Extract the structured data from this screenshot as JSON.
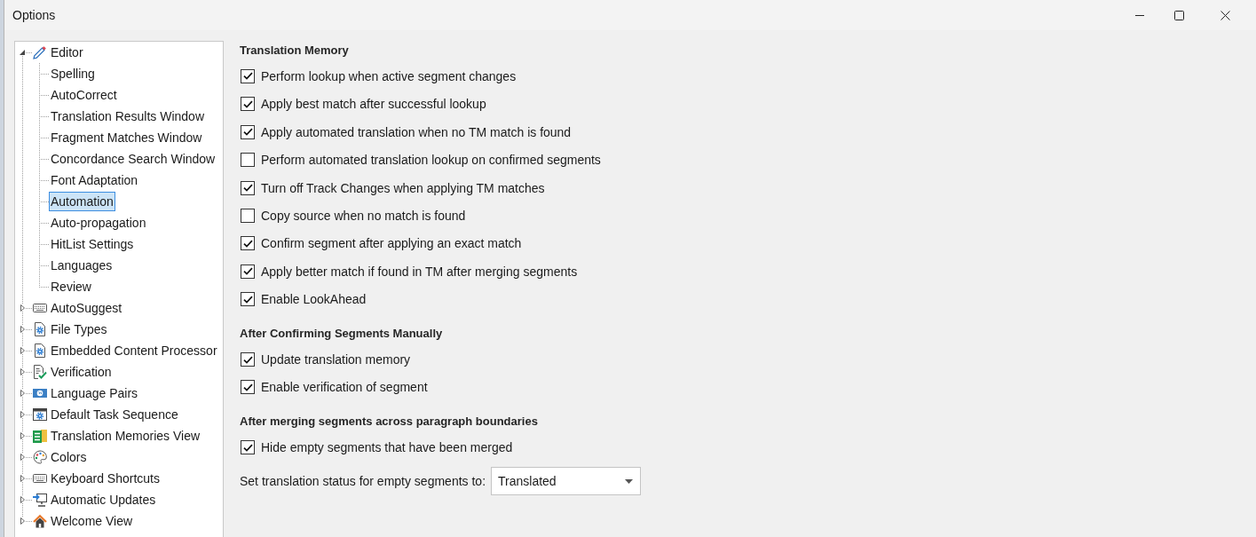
{
  "window": {
    "title": "Options"
  },
  "tree": [
    {
      "label": "Editor",
      "expanded": true,
      "selected": false,
      "children": [
        {
          "label": "Spelling",
          "selected": false
        },
        {
          "label": "AutoCorrect",
          "selected": false
        },
        {
          "label": "Translation Results Window",
          "selected": false
        },
        {
          "label": "Fragment Matches Window",
          "selected": false
        },
        {
          "label": "Concordance Search Window",
          "selected": false
        },
        {
          "label": "Font Adaptation",
          "selected": false
        },
        {
          "label": "Automation",
          "selected": true
        },
        {
          "label": "Auto-propagation",
          "selected": false
        },
        {
          "label": "HitList Settings",
          "selected": false
        },
        {
          "label": "Languages",
          "selected": false
        },
        {
          "label": "Review",
          "selected": false
        }
      ]
    },
    {
      "label": "AutoSuggest",
      "expanded": false,
      "selected": false
    },
    {
      "label": "File Types",
      "expanded": false,
      "selected": false
    },
    {
      "label": "Embedded Content Processor",
      "expanded": false,
      "selected": false
    },
    {
      "label": "Verification",
      "expanded": false,
      "selected": false
    },
    {
      "label": "Language Pairs",
      "expanded": false,
      "selected": false
    },
    {
      "label": "Default Task Sequence",
      "expanded": false,
      "selected": false
    },
    {
      "label": "Translation Memories View",
      "expanded": false,
      "selected": false
    },
    {
      "label": "Colors",
      "expanded": false,
      "selected": false
    },
    {
      "label": "Keyboard Shortcuts",
      "expanded": false,
      "selected": false
    },
    {
      "label": "Automatic Updates",
      "expanded": false,
      "selected": false
    },
    {
      "label": "Welcome View",
      "expanded": false,
      "selected": false
    }
  ],
  "sections": [
    {
      "heading": "Translation Memory",
      "items": [
        {
          "kind": "checkbox",
          "label": "Perform lookup when active segment changes",
          "checked": true
        },
        {
          "kind": "checkbox",
          "label": "Apply best match after successful lookup",
          "checked": true
        },
        {
          "kind": "checkbox",
          "label": "Apply automated translation when no TM match is found",
          "checked": true
        },
        {
          "kind": "checkbox",
          "label": "Perform automated translation lookup on confirmed segments",
          "checked": false
        },
        {
          "kind": "checkbox",
          "label": "Turn off Track Changes when applying TM matches",
          "checked": true
        },
        {
          "kind": "checkbox",
          "label": "Copy source when no match is found",
          "checked": false
        },
        {
          "kind": "checkbox",
          "label": "Confirm segment after applying an exact match",
          "checked": true
        },
        {
          "kind": "checkbox",
          "label": "Apply better match if found in TM after merging segments",
          "checked": true
        },
        {
          "kind": "checkbox",
          "label": "Enable LookAhead",
          "checked": true
        }
      ]
    },
    {
      "heading": "After Confirming Segments Manually",
      "items": [
        {
          "kind": "checkbox",
          "label": "Update translation memory",
          "checked": true
        },
        {
          "kind": "checkbox",
          "label": "Enable verification of segment",
          "checked": true
        }
      ]
    },
    {
      "heading": "After merging segments across paragraph boundaries",
      "items": [
        {
          "kind": "checkbox",
          "label": "Hide empty segments that have been merged",
          "checked": true
        },
        {
          "kind": "dropdown",
          "label": "Set translation status for empty segments to:",
          "value": "Translated"
        }
      ]
    }
  ]
}
